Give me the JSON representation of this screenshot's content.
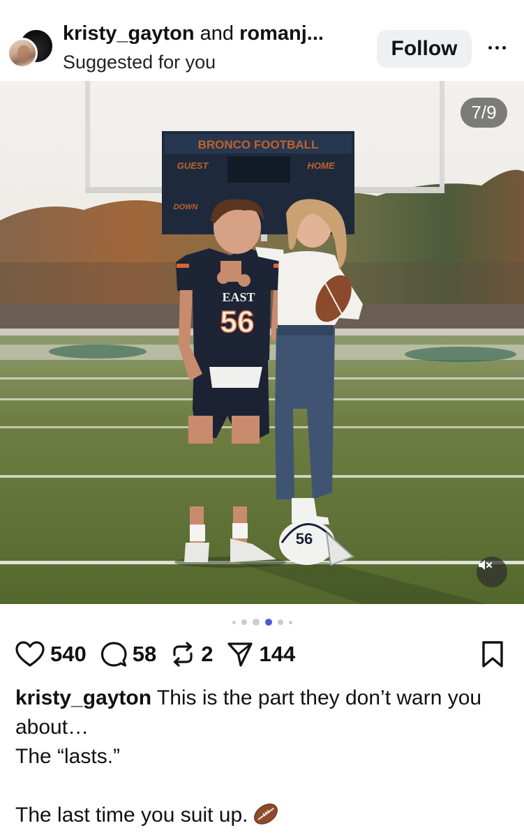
{
  "header": {
    "primary_author": "kristy_gayton",
    "and_text": " and ",
    "collaborator": "romanj...",
    "subtitle": "Suggested for you",
    "follow_label": "Follow",
    "avatar_icon": "profile-avatar",
    "more_icon": "more-horizontal-icon"
  },
  "media": {
    "counter": "7/9",
    "scoreboard_title": "BRONCO FOOTBALL",
    "scoreboard_guest": "GUEST",
    "scoreboard_home": "HOME",
    "scoreboard_down": "DOWN",
    "jersey_text": "EAST",
    "jersey_number": "56",
    "helmet_number": "56",
    "mute_icon": "speaker-muted-icon"
  },
  "carousel": {
    "dots_total": 6,
    "active_index": 3,
    "active_color": "#4f5bd5",
    "inactive_color": "#c8ccd3"
  },
  "actions": {
    "likes": "540",
    "comments": "58",
    "reposts": "2",
    "shares": "144",
    "like_icon": "heart-icon",
    "comment_icon": "comment-bubble-icon",
    "repost_icon": "repost-icon",
    "share_icon": "send-icon",
    "save_icon": "bookmark-icon"
  },
  "caption": {
    "username": "kristy_gayton",
    "text_line1": " This is the part they don’t warn you about…",
    "text_line2": "The “lasts.”",
    "text_line3": "The last time you suit up.",
    "emoji_icon": "american-football-icon"
  }
}
